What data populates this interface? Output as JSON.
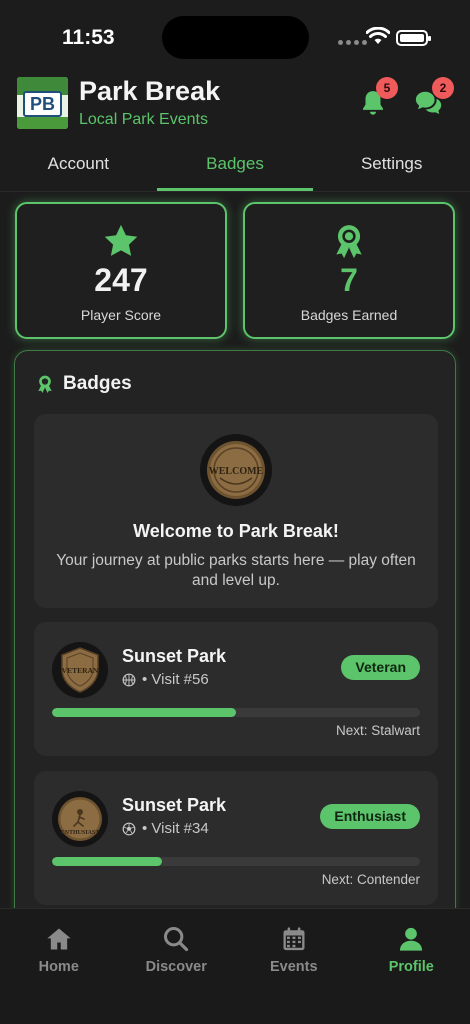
{
  "status": {
    "time": "11:53"
  },
  "header": {
    "logo_text": "PB",
    "title": "Park Break",
    "subtitle": "Local Park Events",
    "notifications_count": "5",
    "messages_count": "2"
  },
  "tabs": [
    {
      "label": "Account",
      "active": false
    },
    {
      "label": "Badges",
      "active": true
    },
    {
      "label": "Settings",
      "active": false
    }
  ],
  "stats": {
    "score": {
      "value": "247",
      "label": "Player Score",
      "icon": "star-icon"
    },
    "badges": {
      "value": "7",
      "label": "Badges Earned",
      "icon": "award-icon"
    }
  },
  "badges_panel": {
    "title": "Badges",
    "welcome": {
      "medal_text": "WELCOME",
      "title": "Welcome to Park Break!",
      "text": "Your journey at public parks starts here — play often and level up."
    },
    "items": [
      {
        "park": "Sunset Park",
        "sport_icon": "basketball-icon",
        "visit": "• Visit #56",
        "level": "Veteran",
        "medal_text": "VETERAN",
        "progress": 0.5,
        "next": "Next: Stalwart"
      },
      {
        "park": "Sunset Park",
        "sport_icon": "soccer-ball-icon",
        "visit": "• Visit #34",
        "level": "Enthusiast",
        "medal_text": "ENTHUSIAST",
        "progress": 0.3,
        "next": "Next: Contender"
      }
    ]
  },
  "bottom_nav": [
    {
      "label": "Home",
      "icon": "home-icon",
      "active": false
    },
    {
      "label": "Discover",
      "icon": "search-icon",
      "active": false
    },
    {
      "label": "Events",
      "icon": "calendar-icon",
      "active": false
    },
    {
      "label": "Profile",
      "icon": "person-icon",
      "active": true
    }
  ],
  "colors": {
    "accent": "#5cc46a",
    "alert": "#ef5a5a",
    "background": "#1c1c1c"
  }
}
